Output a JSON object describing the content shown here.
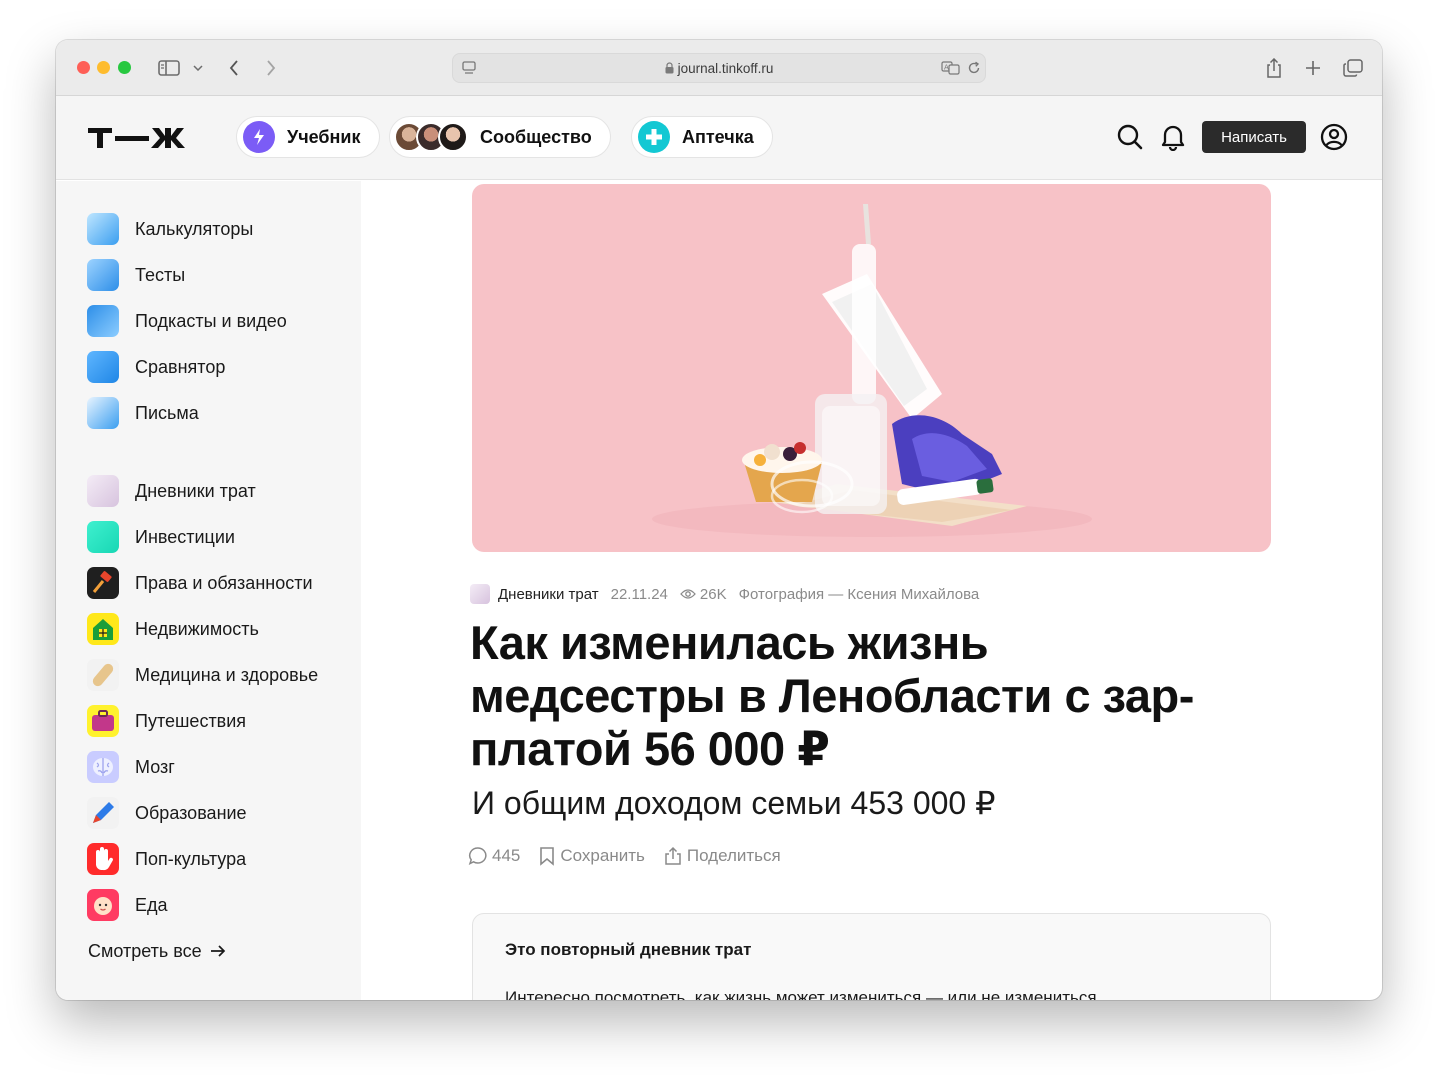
{
  "browser": {
    "url": "journal.tinkoff.ru"
  },
  "header": {
    "logo_text": "Т—Ж",
    "pills": [
      {
        "label": "Учебник"
      },
      {
        "label": "Сообщество"
      },
      {
        "label": "Аптечка"
      }
    ],
    "write_label": "Написать"
  },
  "sidebar": {
    "tools": [
      {
        "label": "Калькуляторы",
        "icon": "calculator-icon",
        "color": "#3aa0f0"
      },
      {
        "label": "Тесты",
        "icon": "gamepad-icon",
        "color": "#3aa0f0"
      },
      {
        "label": "Подкасты и видео",
        "icon": "play-icon",
        "color": "#3aa0f0"
      },
      {
        "label": "Сравнятор",
        "icon": "compare-icon",
        "color": "#3aa0f0"
      },
      {
        "label": "Письма",
        "icon": "letter-icon",
        "color": "#3aa0f0"
      }
    ],
    "topics": [
      {
        "label": "Дневники трат",
        "icon": "diary-icon",
        "color": "#efe4f2"
      },
      {
        "label": "Инвестиции",
        "icon": "investments-icon",
        "color": "#2ee6c4"
      },
      {
        "label": "Права и обязанности",
        "icon": "gavel-icon",
        "color": "#1f1f1f"
      },
      {
        "label": "Недвижимость",
        "icon": "house-icon",
        "color": "#ffe81a"
      },
      {
        "label": "Медицина и здоровье",
        "icon": "bandage-icon",
        "color": "#f2f2f2"
      },
      {
        "label": "Путешествия",
        "icon": "suitcase-icon",
        "color": "#fff22e"
      },
      {
        "label": "Мозг",
        "icon": "brain-icon",
        "color": "#c9ccff"
      },
      {
        "label": "Образование",
        "icon": "pen-icon",
        "color": "#f2f2f2"
      },
      {
        "label": "Поп-культура",
        "icon": "hand-icon",
        "color": "#ff2b2b"
      },
      {
        "label": "Еда",
        "icon": "baby-icon",
        "color": "#ff3b62"
      }
    ],
    "see_all": "Смотреть все"
  },
  "article": {
    "category": "Дневники трат",
    "date": "22.11.24",
    "views": "26K",
    "photo_credit": "Фотография — Ксения Михайлова",
    "title": "Как изменилась жизнь медсестры в Ленобласти с зар­платой 56 000 ₽",
    "subtitle": "И общим доходом семьи 453 000 ₽",
    "comments": "445",
    "save_label": "Сохранить",
    "share_label": "Поделиться",
    "note_title": "Это повторный дневник трат",
    "note_text": "Интересно посмотреть, как жизнь может измениться — или не измениться"
  },
  "colors": {
    "hero_bg": "#f7c2c7",
    "accent_purple": "#7b5cf6",
    "accent_teal": "#13c8d3"
  }
}
